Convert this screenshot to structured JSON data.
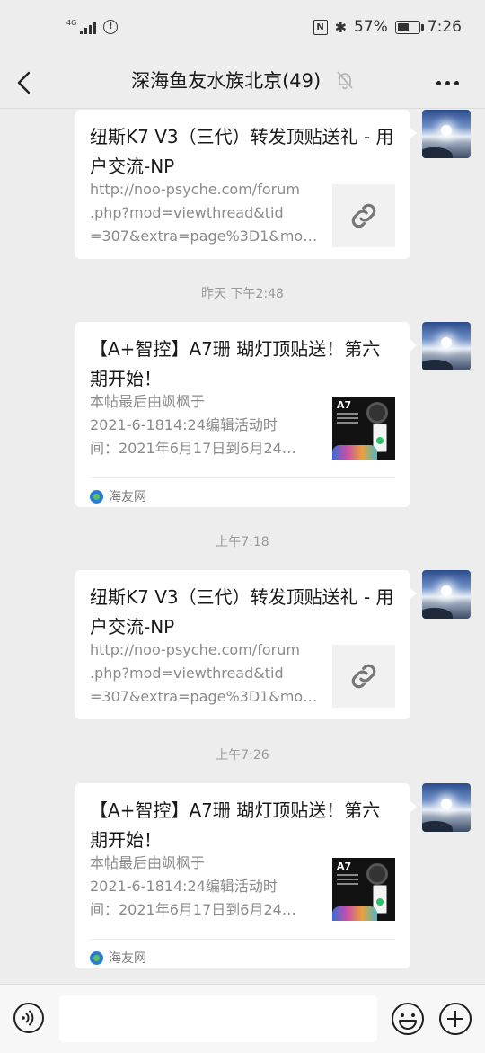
{
  "status_bar": {
    "network": "4G",
    "battery_percent": "57%",
    "battery_level": 0.57,
    "time": "7:26"
  },
  "header": {
    "title": "深海鱼友水族北京(49)",
    "back_icon": "chevron-left-icon",
    "mute_icon": "bell-off-icon",
    "more_icon": "more-dots-icon"
  },
  "messages": [
    {
      "title": "纽斯K7 V3（三代）转发顶贴送礼 - 用户交流-NP",
      "desc": [
        "http://noo-psyche.com/forum",
        ".php?mod=viewthread&tid",
        "=307&extra=page%3D1&mo…"
      ],
      "thumb": "link-icon"
    },
    {
      "time": "昨天 下午2:48",
      "title": "【A+智控】A7珊 瑚灯顶贴送！第六期开始！",
      "desc": [
        "本帖最后由飒枫于",
        "2021-6-1814:24编辑活动时",
        "间：2021年6月17日到6月24…"
      ],
      "thumb_label": "A7",
      "source": "海友网"
    },
    {
      "time": "上午7:18",
      "title": "纽斯K7 V3（三代）转发顶贴送礼 - 用户交流-NP",
      "desc": [
        "http://noo-psyche.com/forum",
        ".php?mod=viewthread&tid",
        "=307&extra=page%3D1&mo…"
      ],
      "thumb": "link-icon"
    },
    {
      "time": "上午7:26",
      "title": "【A+智控】A7珊 瑚灯顶贴送！第六期开始！",
      "desc": [
        "本帖最后由飒枫于",
        "2021-6-1814:24编辑活动时",
        "间：2021年6月17日到6月24…"
      ],
      "thumb_label": "A7",
      "source": "海友网"
    }
  ],
  "input_bar": {
    "value": "",
    "voice_icon": "voice-icon",
    "emoji_icon": "emoji-icon",
    "plus_icon": "plus-icon"
  }
}
